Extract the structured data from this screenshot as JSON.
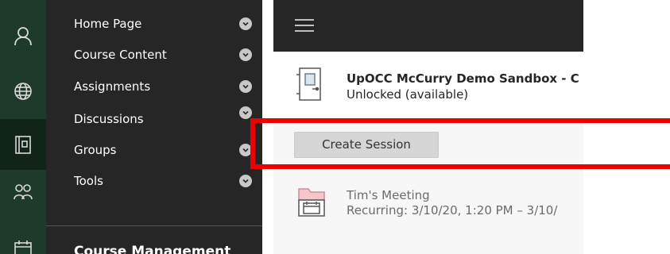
{
  "rail": {
    "items": [
      {
        "icon": "user-icon"
      },
      {
        "icon": "globe-icon"
      },
      {
        "icon": "courses-icon",
        "active": true
      },
      {
        "icon": "groups-icon"
      },
      {
        "icon": "calendar-icon"
      }
    ]
  },
  "menu": {
    "items": [
      {
        "label": "Home Page"
      },
      {
        "label": "Course Content"
      },
      {
        "label": "Assignments"
      },
      {
        "label": "Discussions"
      },
      {
        "label": "Groups"
      },
      {
        "label": "Tools"
      }
    ],
    "footer_label": "Course Management"
  },
  "content": {
    "room": {
      "title": "UpOCC McCurry Demo Sandbox - C",
      "status": "Unlocked (available)"
    },
    "create_button_label": "Create Session",
    "session": {
      "title": "Tim's Meeting",
      "recurrence": "Recurring: 3/10/20, 1:20 PM – 3/10/"
    }
  },
  "colors": {
    "rail_bg": "#1d3a2b",
    "menu_bg": "#262626",
    "highlight": "#ee0000",
    "session_icon_accent": "#f4c6cc"
  }
}
